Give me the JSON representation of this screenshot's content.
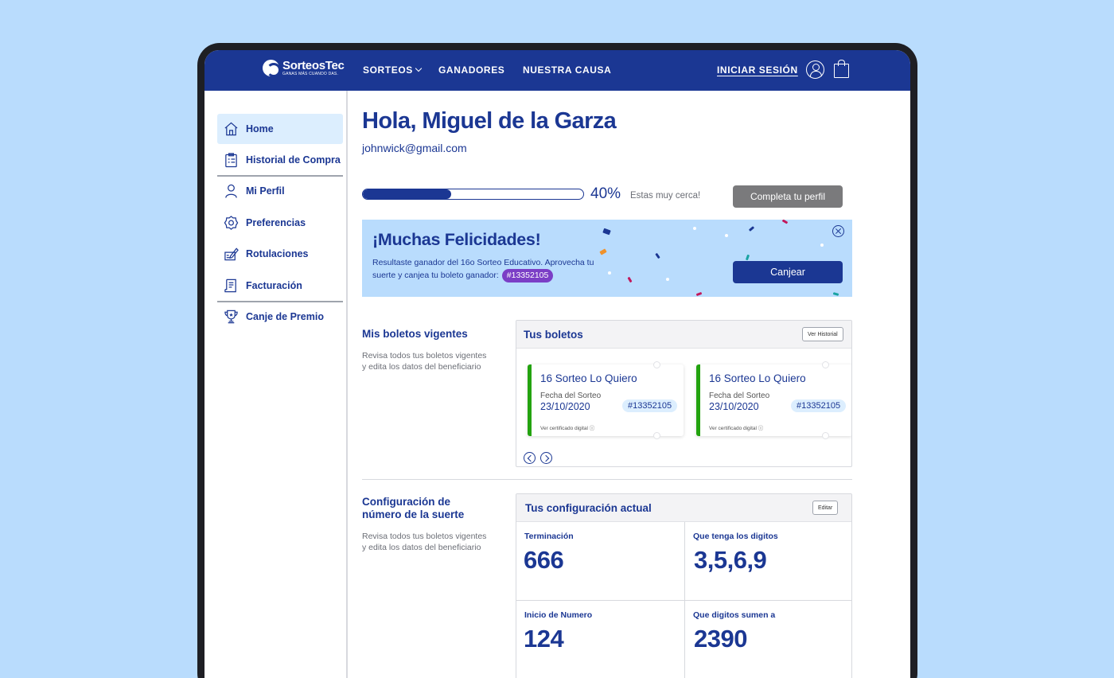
{
  "nav": {
    "logo_name": "SorteosTec",
    "logo_tagline": "GANAS MÁS CUANDO DAS.",
    "links": [
      "SORTEOS",
      "GANADORES",
      "NUESTRA CAUSA"
    ],
    "login": "INICIAR SESIÓN"
  },
  "sidebar": {
    "items": [
      {
        "label": "Home",
        "icon": "home-icon"
      },
      {
        "label": "Historial de Compra",
        "icon": "clipboard-icon"
      },
      {
        "label": "Mi Perfil",
        "icon": "user-icon"
      },
      {
        "label": "Preferencias",
        "icon": "gear-icon"
      },
      {
        "label": "Rotulaciones",
        "icon": "edit-icon"
      },
      {
        "label": "Facturación",
        "icon": "invoice-icon"
      },
      {
        "label": "Canje de Premio",
        "icon": "trophy-icon"
      }
    ]
  },
  "profile": {
    "greeting": "Hola, Miguel de la Garza",
    "email": "johnwick@gmail.com",
    "progress": 40,
    "progress_label": "40%",
    "progress_msg": "Estas muy cerca!",
    "complete_button": "Completa tu perfil"
  },
  "banner": {
    "title": "¡Muchas Felicidades!",
    "text": "Resultaste ganador del 16o Sorteo Educativo. Aprovecha tu suerte y canjea tu boleto ganador:",
    "ticket": "#13352105",
    "button": "Canjear"
  },
  "tickets_section": {
    "title": "Mis boletos vigentes",
    "desc": "Revisa todos tus boletos vigentes y edita los datos del beneficiario",
    "panel_title": "Tus boletos",
    "panel_button": "Ver Historial",
    "tickets": [
      {
        "name": "16 Sorteo Lo Quiero",
        "date_label": "Fecha del Sorteo",
        "date": "23/10/2020",
        "number": "#13352105",
        "cert": "Ver certificado digital ⓘ"
      },
      {
        "name": "16 Sorteo Lo Quiero",
        "date_label": "Fecha del Sorteo",
        "date": "23/10/2020",
        "number": "#13352105",
        "cert": "Ver certificado digital ⓘ"
      }
    ]
  },
  "config_section": {
    "title": "Configuración de número de la suerte",
    "desc": "Revisa todos tus boletos vigentes y edita los datos del beneficiario",
    "panel_title": "Tus configuración actual",
    "panel_button": "Editar",
    "cells": [
      {
        "label": "Terminación",
        "value": "666"
      },
      {
        "label": "Que tenga los digitos",
        "value": "3,5,6,9"
      },
      {
        "label": "Inicio de Numero",
        "value": "124"
      },
      {
        "label": "Que digitos sumen a",
        "value": "2390"
      }
    ]
  },
  "colors": {
    "brand": "#1b3793",
    "background": "#b9dcfd",
    "chip": "#7b3ec6",
    "ticket_accent": "#23a30f"
  }
}
